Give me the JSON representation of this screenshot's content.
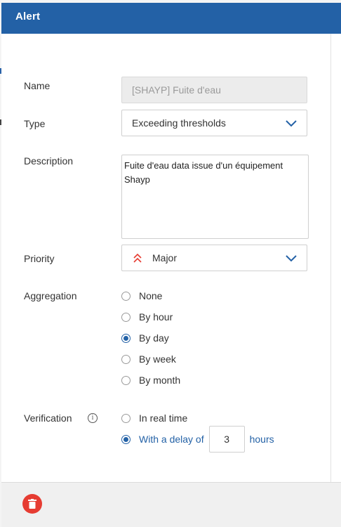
{
  "modal": {
    "title": "Alert"
  },
  "form": {
    "name": {
      "label": "Name",
      "value": "[SHAYP] Fuite d'eau"
    },
    "type": {
      "label": "Type",
      "value": "Exceeding thresholds"
    },
    "description": {
      "label": "Description",
      "value": "Fuite d'eau data issue d'un équipement Shayp"
    },
    "priority": {
      "label": "Priority",
      "value": "Major",
      "icon": "double-chevron-up-icon",
      "icon_color": "#e63c32"
    },
    "aggregation": {
      "label": "Aggregation",
      "options": [
        "None",
        "By hour",
        "By day",
        "By week",
        "By month"
      ],
      "selected": "By day"
    },
    "verification": {
      "label": "Verification",
      "info_icon": "i",
      "realtime_label": "In real time",
      "delay_prefix": "With a delay of",
      "delay_value": "3",
      "delay_suffix": "hours",
      "selected": "delay"
    }
  },
  "footer": {
    "delete_icon": "trash-icon"
  },
  "colors": {
    "primary": "#2361a6",
    "danger": "#e63c32"
  }
}
